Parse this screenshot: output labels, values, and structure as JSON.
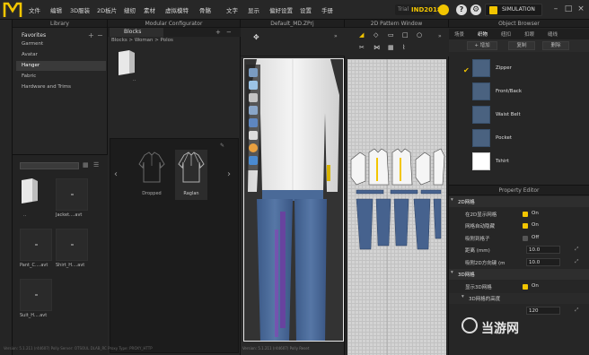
{
  "app": {
    "logo": "M",
    "menu": [
      "文件",
      "编辑",
      "3D服装",
      "2D板片",
      "缝纫",
      "素材",
      "虚拟模特",
      "骨骼",
      "文字",
      "显示",
      "偏好设置",
      "设置",
      "手册"
    ],
    "version_prefix": "Trial",
    "version": "IND2018",
    "simulation_label": "SIMULATION",
    "help_icon": "help-icon",
    "settings_icon": "gear-icon"
  },
  "library": {
    "title": "Library",
    "favorites": "Favorites",
    "items": [
      "Garment",
      "Avatar",
      "Hanger",
      "Fabric",
      "Hardware and Trims"
    ],
    "selected_index": 2,
    "files": [
      "..",
      "Jacket....avt",
      "...",
      "Shirt_H....avt",
      "Pant_C....avt",
      "Suit_H....avt"
    ]
  },
  "modular": {
    "title": "Modular Configurator",
    "tab": "Blocks",
    "breadcrumb": "Blocks > Woman > Polos",
    "top_file": "..",
    "styles": [
      "Dropped",
      "Raglan"
    ]
  },
  "viewport3d": {
    "title": "Default_MD.ZPrj",
    "status": "Version: 5.1.211 (r44607)  Polly Reset"
  },
  "pattern2d": {
    "title": "2D Pattern Window"
  },
  "object_browser": {
    "title": "Object Browser",
    "tabs": [
      "场景",
      "织物",
      "纽扣",
      "扣眼",
      "缝线"
    ],
    "selected_tab": 1,
    "buttons": [
      "+ 增加",
      "复制",
      "删除"
    ],
    "fabrics": [
      {
        "name": "Zipper",
        "color": "#4a6280"
      },
      {
        "name": "Front/Back",
        "color": "#4a6280"
      },
      {
        "name": "Waist Belt",
        "color": "#4a6280"
      },
      {
        "name": "Pocket",
        "color": "#4a6280"
      },
      {
        "name": "Tshirt",
        "color": "#ffffff"
      }
    ]
  },
  "property_editor": {
    "title": "Property Editor",
    "rows": [
      {
        "label": "2D网格",
        "kind": "section"
      },
      {
        "label": "在2D显示网格",
        "kind": "check",
        "value": "On"
      },
      {
        "label": "网格自动隐藏",
        "kind": "check",
        "value": "On"
      },
      {
        "label": "吸附到格子",
        "kind": "check_off",
        "value": "Off"
      },
      {
        "label": "距离 (mm)",
        "kind": "input",
        "value": "10.0"
      },
      {
        "label": "吸附2D方向键 (m",
        "kind": "input",
        "value": "10.0"
      },
      {
        "label": "3D网格",
        "kind": "section"
      },
      {
        "label": "显示3D网格",
        "kind": "check",
        "value": "On"
      },
      {
        "label": "3D网格的高度",
        "kind": "sub",
        "value": ""
      },
      {
        "label": "",
        "kind": "input",
        "value": "120"
      }
    ]
  },
  "watermark": "当游网",
  "status": "Version: 5.1.211 (r44607)   Polly Server: OTSOUL DLAB_RC  Proxy Type: PROXY_HTTP"
}
